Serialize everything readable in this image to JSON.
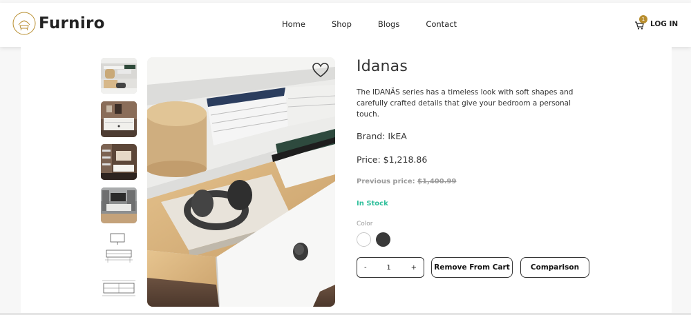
{
  "brand": {
    "name": "Furniro"
  },
  "nav": {
    "items": [
      "Home",
      "Shop",
      "Blogs",
      "Contact"
    ]
  },
  "cart": {
    "count": "1",
    "icon": "cart-icon"
  },
  "auth": {
    "login_label": "LOG IN"
  },
  "product": {
    "title": "Idanas",
    "description": "The IDANÄS series has a timeless look with soft shapes and carefully crafted details that give your bedroom a personal touch.",
    "brand_label": "Brand: IkEA",
    "price_label": "Price: $1,218.86",
    "previous_price_prefix": "Previous price:",
    "previous_price_value": "$1,400.99",
    "stock_status": "In Stock",
    "color_label": "Color",
    "colors": [
      "#ffffff",
      "#3a3a3a"
    ],
    "quantity": "1",
    "qty_minus": "-",
    "qty_plus": "+",
    "remove_label": "Remove From Cart",
    "compare_label": "Comparison",
    "accent_color": "#b88e2f",
    "stock_color": "#2ebf9b"
  }
}
